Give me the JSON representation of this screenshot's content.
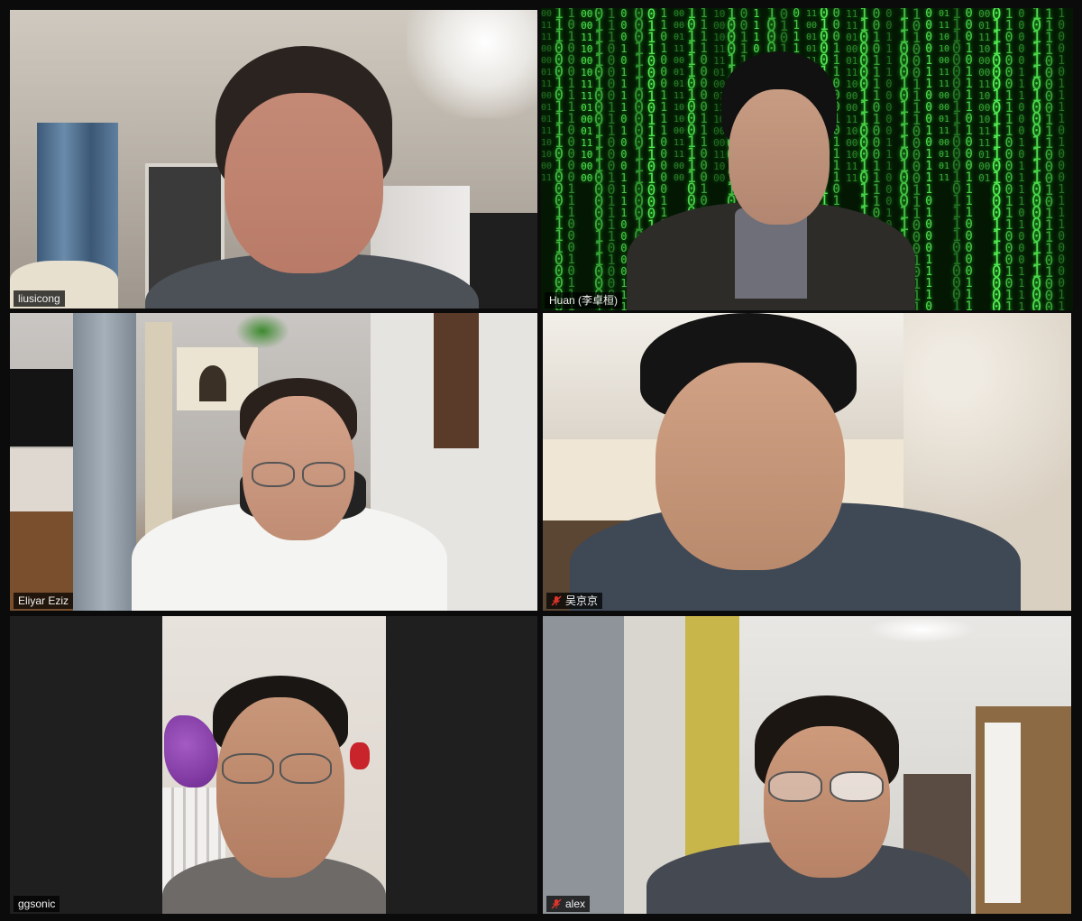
{
  "meeting": {
    "layout": "gallery-view",
    "participants": [
      {
        "name": "liusicong",
        "muted": false,
        "active_speaker": false
      },
      {
        "name": "Huan (李卓桓)",
        "muted": false,
        "active_speaker": true
      },
      {
        "name": "Eliyar Eziz",
        "muted": false,
        "active_speaker": false
      },
      {
        "name": "吴京京",
        "muted": true,
        "active_speaker": false
      },
      {
        "name": "ggsonic",
        "muted": false,
        "active_speaker": false
      },
      {
        "name": "alex",
        "muted": true,
        "active_speaker": false
      }
    ]
  },
  "colors": {
    "active_border": "#d9e89a",
    "muted_icon": "#e0352b",
    "matrix_green": "#5dff5d"
  },
  "icons": {
    "muted": "microphone-muted-icon"
  }
}
